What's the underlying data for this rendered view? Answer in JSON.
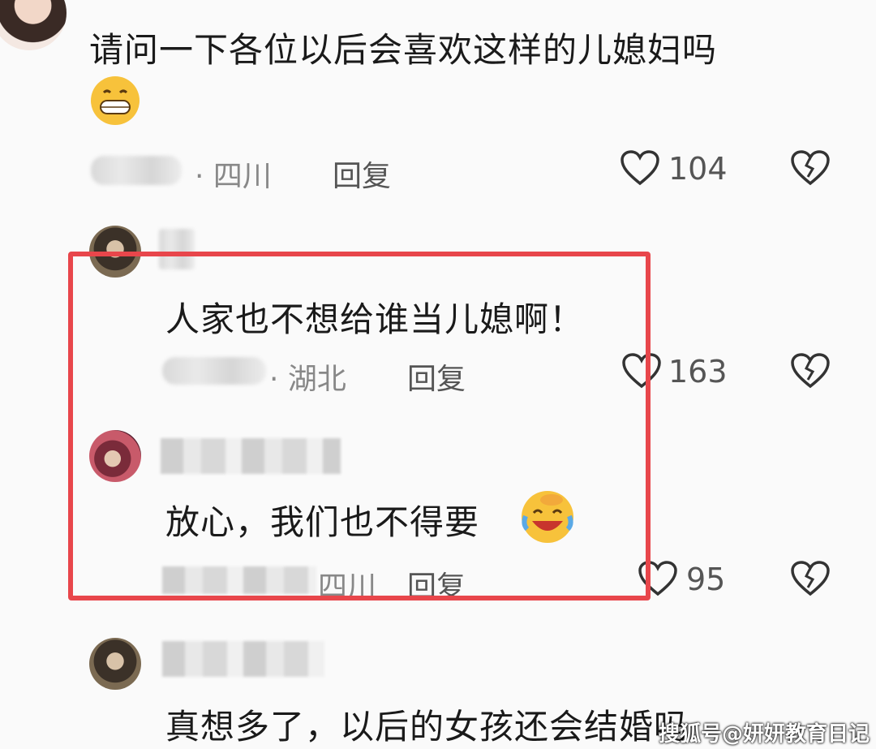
{
  "colors": {
    "highlight": "#e8464b",
    "meta_text": "#888888",
    "background": "#fafafa"
  },
  "comments": [
    {
      "text": "请问一下各位以后会喜欢这样的儿媳妇吗",
      "emoji": "grinning-face",
      "location": "· 四川",
      "reply": "回复",
      "likes": "104"
    },
    {
      "text": "人家也不想给谁当儿媳啊！",
      "location": "· 湖北",
      "reply": "回复",
      "likes": "163"
    },
    {
      "text": "放心，我们也不得要",
      "emoji": "crying-laughing-face",
      "location": "四川",
      "reply": "回复",
      "likes": "95"
    },
    {
      "text": "真想多了，以后的女孩还会结婚吗"
    }
  ],
  "watermark": "搜狐号@妍妍教育日记",
  "icons": [
    "heart-icon",
    "broken-heart-icon"
  ]
}
